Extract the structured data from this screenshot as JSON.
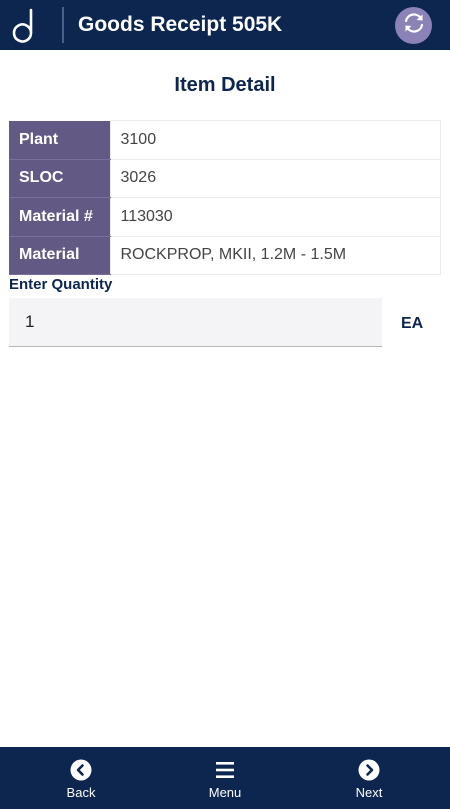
{
  "header": {
    "title": "Goods Receipt 505K",
    "logo_icon": "d-logo-icon",
    "refresh_icon": "refresh-icon"
  },
  "main": {
    "title": "Item Detail",
    "details": [
      {
        "label": "Plant",
        "value": "3100"
      },
      {
        "label": "SLOC",
        "value": "3026"
      },
      {
        "label": "Material #",
        "value": "113030"
      },
      {
        "label": "Material",
        "value": "ROCKPROP, MKII, 1.2M - 1.5M"
      }
    ],
    "quantity": {
      "label": "Enter Quantity",
      "value": "1",
      "unit": "EA"
    }
  },
  "footer": {
    "back_label": "Back",
    "menu_label": "Menu",
    "next_label": "Next"
  },
  "colors": {
    "brand_navy": "#0c2650",
    "label_purple": "#635985",
    "refresh_lavender": "#8b83b8"
  }
}
